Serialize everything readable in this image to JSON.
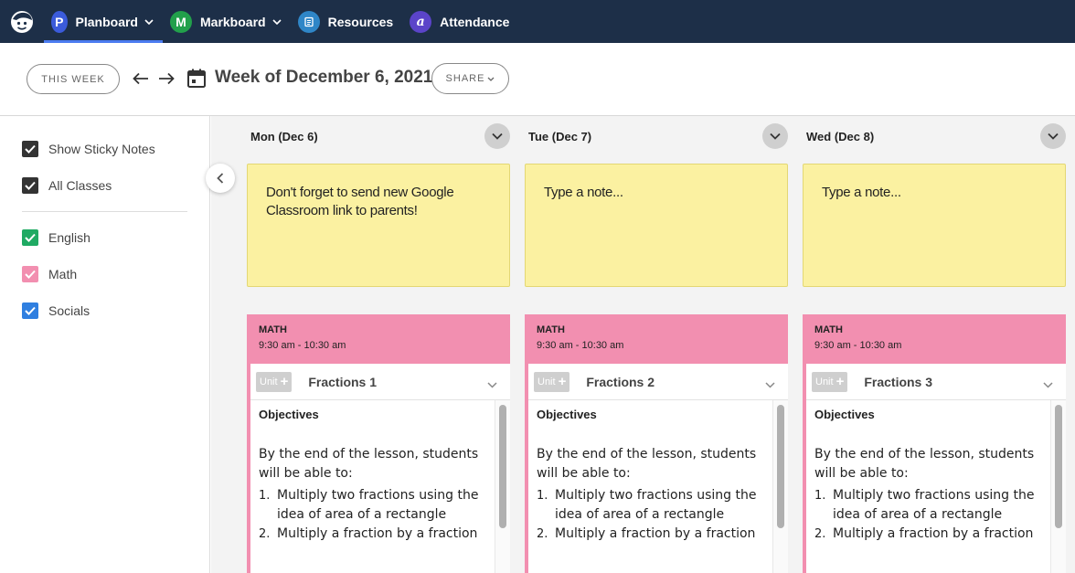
{
  "nav": {
    "items": [
      {
        "label": "Planboard",
        "badge": "P",
        "badge_color": "#3b5bdb",
        "has_caret": true,
        "active": true
      },
      {
        "label": "Markboard",
        "badge": "M",
        "badge_color": "#22a04b",
        "has_caret": true,
        "active": false
      },
      {
        "label": "Resources",
        "badge": "",
        "badge_color": "#2f86c7",
        "has_caret": false,
        "active": false
      },
      {
        "label": "Attendance",
        "badge": "a",
        "badge_color": "#5b44c9",
        "has_caret": false,
        "active": false
      }
    ]
  },
  "toolbar": {
    "this_week_label": "THIS WEEK",
    "week_title": "Week of December 6, 2021",
    "share_label": "SHARE"
  },
  "sidebar": {
    "filters": [
      {
        "label": "Show Sticky Notes",
        "checked": true,
        "color": "#333333"
      },
      {
        "label": "All Classes",
        "checked": true,
        "color": "#333333"
      },
      {
        "label": "English",
        "checked": true,
        "color": "#1faa63"
      },
      {
        "label": "Math",
        "checked": true,
        "color": "#f28fb0"
      },
      {
        "label": "Socials",
        "checked": true,
        "color": "#2f7fe0"
      }
    ]
  },
  "days": [
    {
      "title": "Mon (Dec 6)",
      "note": "Don't forget to send new Google Classroom link to parents!",
      "lesson": {
        "subject": "MATH",
        "time": "9:30 am - 10:30 am",
        "unit_label": "Unit",
        "title": "Fractions 1",
        "objectives_heading": "Objectives",
        "objectives_intro": "By the end of the lesson, students will be able to:",
        "objectives": [
          {
            "num": "1.",
            "text": "Multiply two fractions using the idea of area of a rectangle"
          },
          {
            "num": "2.",
            "text": "Multiply a fraction by a fraction"
          }
        ]
      }
    },
    {
      "title": "Tue (Dec 7)",
      "note": "Type a note...",
      "lesson": {
        "subject": "MATH",
        "time": "9:30 am - 10:30 am",
        "unit_label": "Unit",
        "title": "Fractions 2",
        "objectives_heading": "Objectives",
        "objectives_intro": "By the end of the lesson, students will be able to:",
        "objectives": [
          {
            "num": "1.",
            "text": "Multiply two fractions using the idea of area of a rectangle"
          },
          {
            "num": "2.",
            "text": "Multiply a fraction by a fraction"
          }
        ]
      }
    },
    {
      "title": "Wed (Dec 8)",
      "note": "Type a note...",
      "lesson": {
        "subject": "MATH",
        "time": "9:30 am - 10:30 am",
        "unit_label": "Unit",
        "title": "Fractions 3",
        "objectives_heading": "Objectives",
        "objectives_intro": "By the end of the lesson, students will be able to:",
        "objectives": [
          {
            "num": "1.",
            "text": "Multiply two fractions using the idea of area of a rectangle"
          },
          {
            "num": "2.",
            "text": "Multiply a fraction by a fraction"
          }
        ]
      }
    }
  ],
  "colors": {
    "nav_bg": "#1d2f48",
    "math": "#f28fb0",
    "sticky": "#fbf1a1"
  }
}
